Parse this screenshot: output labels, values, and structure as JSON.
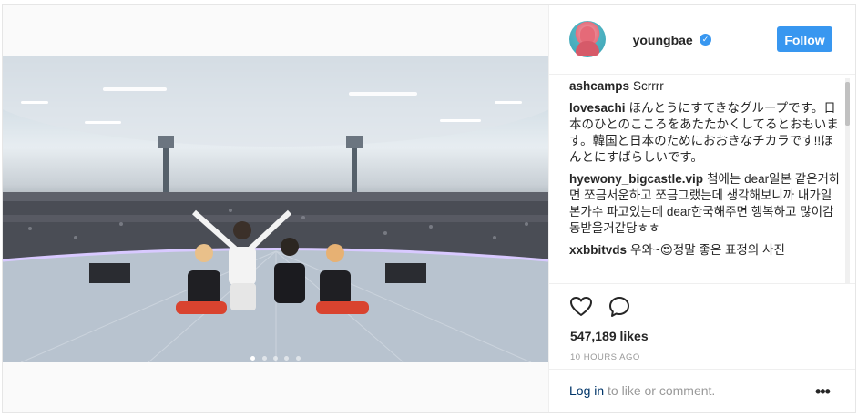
{
  "post": {
    "username": "__youngbae__",
    "follow_label": "Follow",
    "verified_glyph": "✓",
    "comments": [
      {
        "user": "ashcamps",
        "text": "Scrrrr"
      },
      {
        "user": "lovesachi",
        "text": "ほんとうにすてきなグループです。日本のひとのこころをあたたかくしてるとおもいます。韓国と日本のためにおおきなチカラです!!ほんとにすばらしいです。"
      },
      {
        "user": "hyewony_bigcastle.vip",
        "text": "첨에는 dear일본 같은거하면 쪼금서운하고 쪼금그랬는데 생각해보니까 내가일본가수 파고있는데 dear한국해주면 행복하고 많이감동받을거같당ㅎㅎ"
      },
      {
        "user": "xxbbitvds",
        "text": "우와~😍정말 좋은 표정의 사진"
      }
    ],
    "likes": "547,189 likes",
    "time": "10 HOURS AGO",
    "login_link": "Log in",
    "login_rest": " to like or comment.",
    "more_glyph": "•••",
    "carousel": {
      "count": 5,
      "active_index": 0
    }
  },
  "icons": {
    "like": "heart-outline-icon",
    "comment": "speech-bubble-icon",
    "more": "ellipsis-icon",
    "verified": "verified-badge-icon"
  },
  "colors": {
    "accent": "#3897f0",
    "link": "#003569",
    "muted": "#999999",
    "text": "#262626"
  }
}
